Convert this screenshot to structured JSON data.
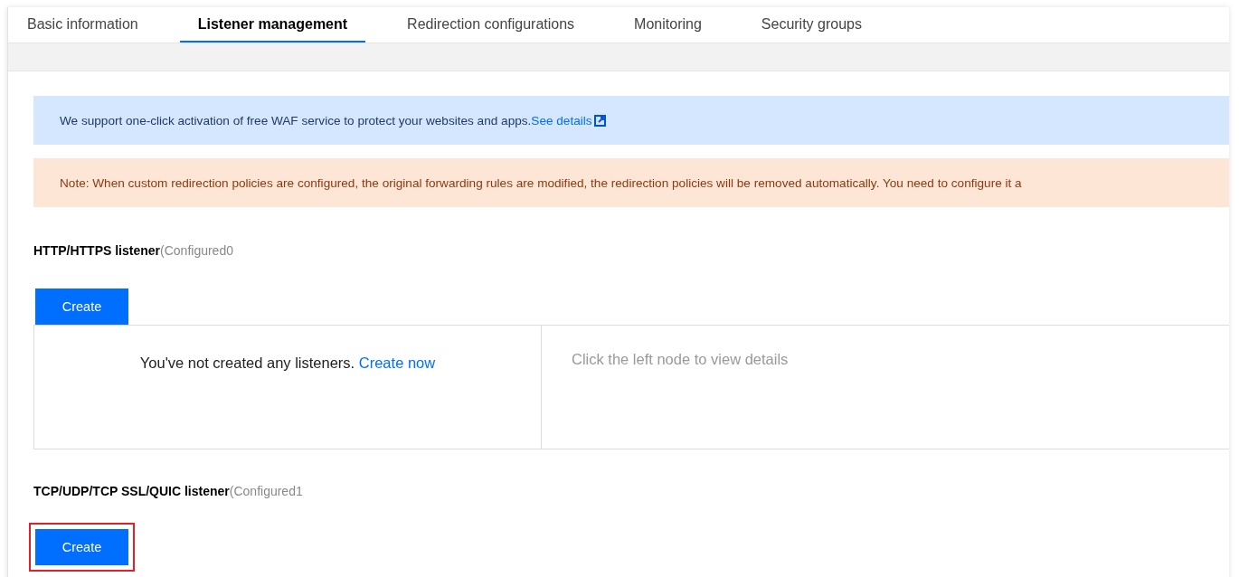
{
  "tabs": [
    {
      "label": "Basic information",
      "selected": false
    },
    {
      "label": "Listener management",
      "selected": true
    },
    {
      "label": "Redirection configurations",
      "selected": false
    },
    {
      "label": "Monitoring",
      "selected": false
    },
    {
      "label": "Security groups",
      "selected": false
    }
  ],
  "notices": [
    {
      "kind": "info",
      "text": "We support one-click activation of free WAF service to protect your websites and apps.",
      "link": "See details"
    },
    {
      "kind": "warning",
      "text": "Note: When custom redirection policies are configured, the original forwarding rules are modified, the redirection policies will be removed automatically. You need to configure it a"
    }
  ],
  "sections": [
    {
      "title": "HTTP/HTTPS listener",
      "count": "(Configured0",
      "button": {
        "label": "Create",
        "highlighted": false
      },
      "panel": {
        "empty_text": "You've not created any listeners.",
        "empty_link": "Create now",
        "details_hint": "Click the left node to view details"
      }
    },
    {
      "title": "TCP/UDP/TCP SSL/QUIC listener",
      "count": "(Configured1",
      "button": {
        "label": "Create",
        "highlighted": true
      }
    }
  ]
}
